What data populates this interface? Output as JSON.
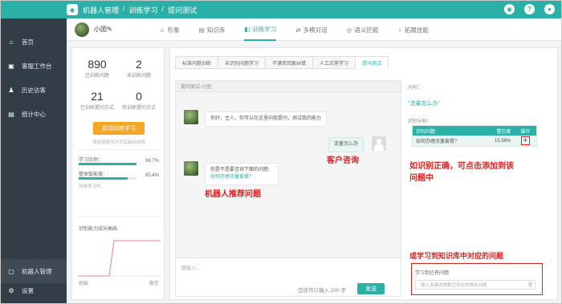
{
  "header": {
    "logo": "◆",
    "crumbs": [
      "机器人管理",
      "/",
      "训练学习",
      "/",
      "提问测试"
    ]
  },
  "sidebar": {
    "items": [
      {
        "icon": "⌂",
        "label": "首页"
      },
      {
        "icon": "▣",
        "label": "客服工作台"
      },
      {
        "icon": "♟",
        "label": "历史访客"
      },
      {
        "icon": "▤",
        "label": "统计中心"
      }
    ],
    "robot_mgmt": {
      "icon": "▢",
      "label": "机器人管理"
    },
    "settings": {
      "icon": "⚙",
      "label": "设置"
    }
  },
  "subbar": {
    "bot_name": "小团✎",
    "tabs": [
      {
        "icon": "☺",
        "label": "形象"
      },
      {
        "icon": "▤",
        "label": "知识库"
      },
      {
        "icon": "◧",
        "label": "训练学习"
      },
      {
        "icon": "⇄",
        "label": "多模对话"
      },
      {
        "icon": "◎",
        "label": "语义挖掘"
      },
      {
        "icon": "♀",
        "label": "拓展技能"
      }
    ]
  },
  "stats": {
    "trained_q": "890",
    "trained_q_label": "已训练问题",
    "untrained_q": "2",
    "untrained_q_label": "未训练问题",
    "trained_way": "21",
    "trained_way_label": "已训练提问方式",
    "untrained_way": "0",
    "untrained_way_label": "待训练提问方式",
    "start_button": "启动训练学习",
    "hint": "请添加提问方式后启动训练",
    "learn_ratio_label": "学习比例：",
    "learn_ratio": "99.7%",
    "learn_ratio_value": 99.7,
    "maturity_label": "整体智能度：",
    "maturity": "85.4%",
    "maturity_value": 85.4,
    "learning": "持续学习中...",
    "curve_title": "识别能力成长曲线",
    "axis_start": "初始",
    "axis_end": "现在"
  },
  "subtabs": [
    "标准问题训练",
    "未识别问题学习",
    "不满意回复纠错",
    "人工应答学习",
    "提问测试"
  ],
  "chat": {
    "title": "提问测试-小团",
    "bot_msg1": "你好，主人，你可以在这里向我提问，测试我的能力",
    "user_msg": "流量怎么办",
    "label_customer": "客户咨询",
    "bot_msg2_line1": "你是不是要咨询下面的问题：",
    "bot_msg2_link": "如何办理流量套餐？",
    "label_robot": "机器人推荐问题",
    "input_placeholder": "请输入...",
    "input_count": "您还可以输入 200 字",
    "send_button": "发送"
  },
  "right": {
    "question_label": "问句：",
    "question": "\"流量怎么办\"",
    "analysis_label": "识别分析：",
    "table": {
      "headers": [
        "识别问题",
        "置信度",
        "操作"
      ],
      "rows": [
        {
          "q": "如何办理流量套餐？",
          "conf": "15.56%",
          "op": "+"
        }
      ]
    },
    "annotation1_line1": "如识别正确，可点击添加到该",
    "annotation1_line2": "问题中",
    "annotation2": "或学习到知识库中对应的问题",
    "learn_label": "学习到已有问题",
    "search_placeholder": "输入关键词搜索已存在的相关问题",
    "search_icon": "⚲"
  }
}
